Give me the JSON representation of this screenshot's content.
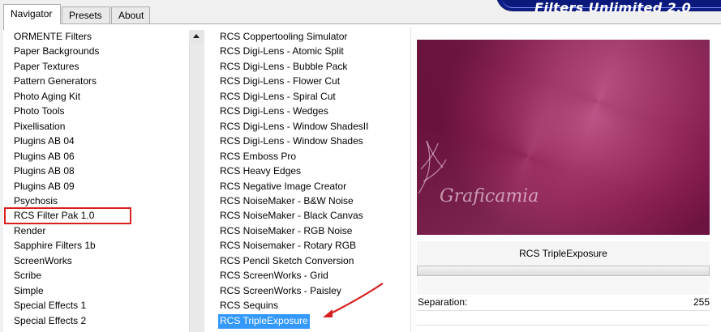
{
  "tabs": [
    {
      "label": "Navigator",
      "active": true
    },
    {
      "label": "Presets",
      "active": false
    },
    {
      "label": "About",
      "active": false
    }
  ],
  "banner": {
    "title": "Filters Unlimited 2.0"
  },
  "categories": [
    "ORMENTE Filters",
    "Paper Backgrounds",
    "Paper Textures",
    "Pattern Generators",
    "Photo Aging Kit",
    "Photo Tools",
    "Pixellisation",
    "Plugins AB 04",
    "Plugins AB 06",
    "Plugins AB 08",
    "Plugins AB 09",
    "Psychosis",
    "RCS Filter Pak 1.0",
    "Render",
    "Sapphire Filters 1b",
    "ScreenWorks",
    "Scribe",
    "Simple",
    "Special Effects 1",
    "Special Effects 2"
  ],
  "selected_category": "RCS Filter Pak 1.0",
  "filters": [
    "RCS Coppertooling Simulator",
    "RCS Digi-Lens - Atomic Split",
    "RCS Digi-Lens - Bubble Pack",
    "RCS Digi-Lens - Flower Cut",
    "RCS Digi-Lens - Spiral Cut",
    "RCS Digi-Lens - Wedges",
    "RCS Digi-Lens - Window ShadesII",
    "RCS Digi-Lens - Window Shades",
    "RCS Emboss Pro",
    "RCS Heavy Edges",
    "RCS Negative Image Creator",
    "RCS NoiseMaker - B&W Noise",
    "RCS NoiseMaker - Black Canvas",
    "RCS NoiseMaker - RGB Noise",
    "RCS Noisemaker - Rotary RGB",
    "RCS Pencil Sketch Conversion",
    "RCS ScreenWorks - Grid",
    "RCS ScreenWorks - Paisley",
    "RCS Sequins",
    "RCS TripleExposure"
  ],
  "selected_filter": "RCS TripleExposure",
  "preview": {
    "watermark": "Graficamia",
    "colors": {
      "light": "#bd4780",
      "mid": "#a62e66",
      "dark": "#741042"
    }
  },
  "filter_title": "RCS TripleExposure",
  "params": [
    {
      "label": "Separation:",
      "value": "255"
    }
  ],
  "colors": {
    "selection": "#3399ff",
    "highlight_box": "#d81e1e",
    "banner": "#0d1d8a"
  }
}
